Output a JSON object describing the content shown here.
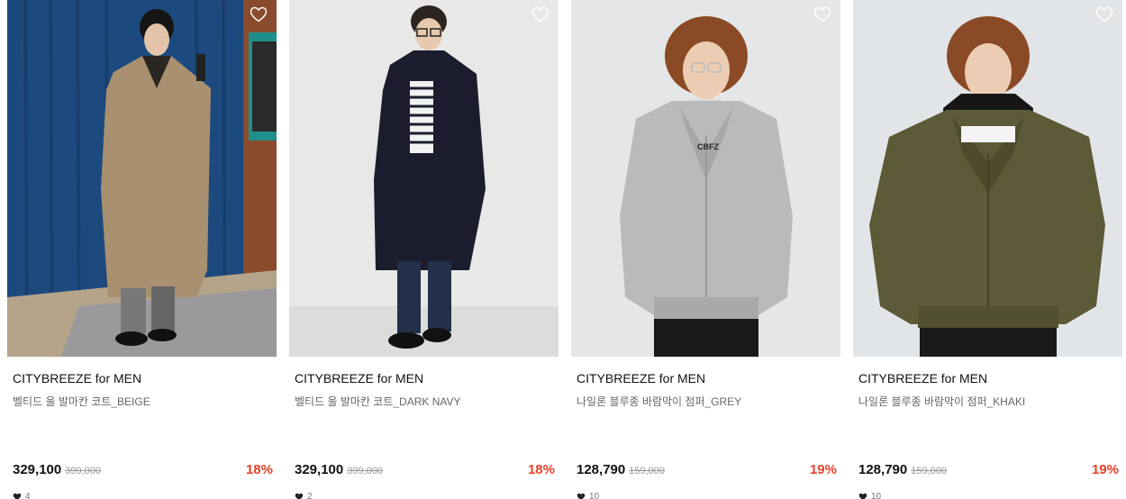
{
  "colors": {
    "discount": "#e8402a",
    "brand_text": "#111111",
    "name_text": "#666666"
  },
  "products": [
    {
      "brand": "CITYBREEZE for MEN",
      "name": "벨티드 울 발마칸 코트_BEIGE",
      "price": "329,100",
      "original_price": "399,000",
      "discount": "18%",
      "likes": "4",
      "photo_icon": "model-photo"
    },
    {
      "brand": "CITYBREEZE for MEN",
      "name": "벨티드 울 발마칸 코트_DARK NAVY",
      "price": "329,100",
      "original_price": "399,000",
      "discount": "18%",
      "likes": "2",
      "photo_icon": "model-photo"
    },
    {
      "brand": "CITYBREEZE for MEN",
      "name": "나일론 블루종 바람막이 점퍼_GREY",
      "price": "128,790",
      "original_price": "159,000",
      "discount": "19%",
      "likes": "10",
      "photo_icon": "model-photo"
    },
    {
      "brand": "CITYBREEZE for MEN",
      "name": "나일론 블루종 바람막이 점퍼_KHAKI",
      "price": "128,790",
      "original_price": "159,000",
      "discount": "19%",
      "likes": "10",
      "photo_icon": "model-photo"
    }
  ]
}
